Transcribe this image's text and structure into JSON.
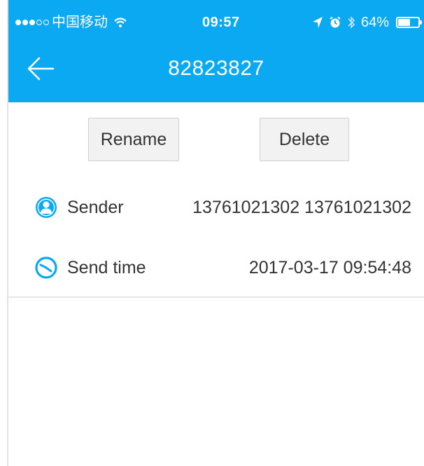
{
  "status_bar": {
    "carrier": "中国移动",
    "time": "09:57",
    "battery_percent": "64%",
    "battery_level": 0.64,
    "signal_bars_filled": 3,
    "signal_bars_total": 5
  },
  "nav": {
    "title": "82823827",
    "back_icon": "arrow-left-icon"
  },
  "actions": {
    "rename_label": "Rename",
    "delete_label": "Delete"
  },
  "details": {
    "sender": {
      "label": "Sender",
      "value": "13761021302 13761021302",
      "icon": "user-icon"
    },
    "send_time": {
      "label": "Send time",
      "value": "2017-03-17  09:54:48",
      "icon": "clock-icon"
    }
  },
  "colors": {
    "header": "#0aa9f2",
    "icon_blue": "#0aa9f2",
    "text": "#333333"
  }
}
